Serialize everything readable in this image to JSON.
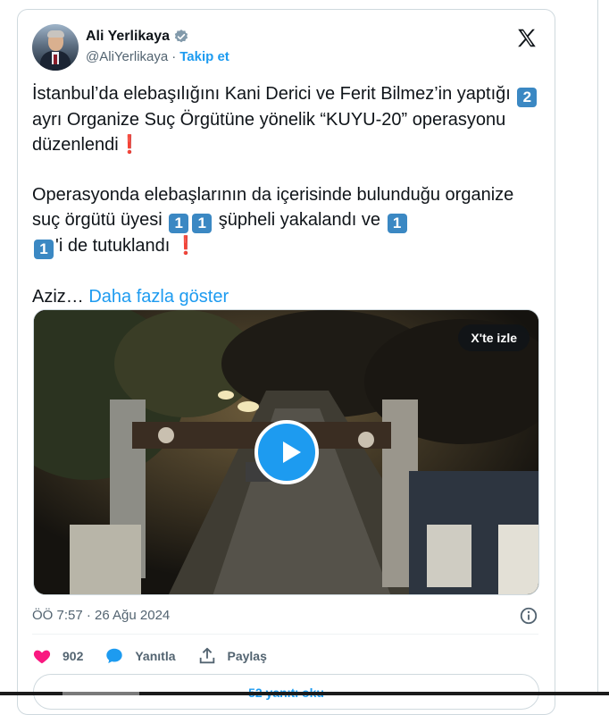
{
  "author": {
    "name": "Ali Yerlikaya",
    "handle": "@AliYerlikaya",
    "separator": "·",
    "follow_label": "Takip et",
    "verified_color": "#829aab"
  },
  "platform_icon": "x-logo-icon",
  "tweet": {
    "p1_a": "İstanbul’da elebaşılığını Kani Derici ve Ferit Bilmez’in yaptığı ",
    "p1_num": "2",
    "p1_b": " ayrı Organize Suç Örgütüne yönelik “KUYU-20” operasyonu düzenlendi",
    "p1_mark": "❗",
    "p2_a": "Operasyonda elebaşlarının da içerisinde bulunduğu organize suç örgütü üyesi ",
    "p2_num1": "1",
    "p2_num2": "1",
    "p2_b": " şüpheli yakalandı ve ",
    "p2_num3": "1",
    "p2_num4": "1",
    "p2_c": "'i de tutuklandı ",
    "p2_mark": "❗",
    "p3_a": "Aziz… ",
    "show_more": "Daha fazla göster"
  },
  "media": {
    "watch_label": "X'te izle",
    "play_icon": "play-icon"
  },
  "meta": {
    "timestamp": "ÖÖ 7:57 · 26 Ağu 2024",
    "info_icon": "info-icon"
  },
  "actions": {
    "likes": "902",
    "reply_label": "Yanıtla",
    "share_label": "Paylaş"
  },
  "replies_button": "52 yanıtı oku",
  "colors": {
    "accent": "#1d9bf0",
    "like": "#f91880",
    "keycap": "#3b88c3",
    "exclamation": "#e0212f"
  }
}
